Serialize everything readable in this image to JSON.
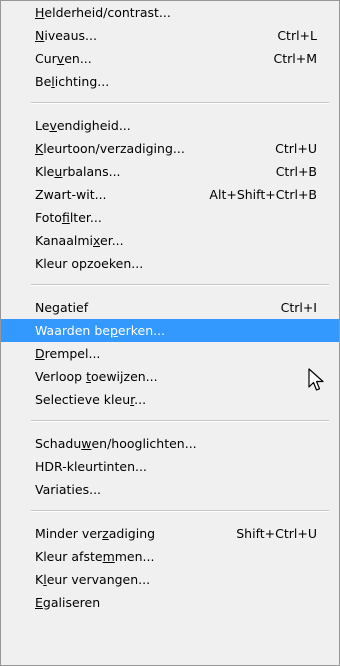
{
  "menu": {
    "groups": [
      {
        "items": [
          {
            "label": "Helderheid/contrast...",
            "shortcut": "",
            "accel": "H"
          },
          {
            "label": "Niveaus...",
            "shortcut": "Ctrl+L",
            "accel": "N"
          },
          {
            "label": "Curven...",
            "shortcut": "Ctrl+M",
            "accel": "v"
          },
          {
            "label": "Belichting...",
            "shortcut": "",
            "accel": "l"
          }
        ]
      },
      {
        "items": [
          {
            "label": "Levendigheid...",
            "shortcut": "",
            "accel": "v"
          },
          {
            "label": "Kleurtoon/verzadiging...",
            "shortcut": "Ctrl+U",
            "accel": "K"
          },
          {
            "label": "Kleurbalans...",
            "shortcut": "Ctrl+B",
            "accel": "u"
          },
          {
            "label": "Zwart-wit...",
            "shortcut": "Alt+Shift+Ctrl+B",
            "accel": ""
          },
          {
            "label": "Fotofilter...",
            "shortcut": "",
            "accel": "f"
          },
          {
            "label": "Kanaalmixer...",
            "shortcut": "",
            "accel": "x"
          },
          {
            "label": "Kleur opzoeken...",
            "shortcut": "",
            "accel": ""
          }
        ]
      },
      {
        "items": [
          {
            "label": "Negatief",
            "shortcut": "Ctrl+I",
            "accel": ""
          },
          {
            "label": "Waarden beperken...",
            "shortcut": "",
            "accel": "p",
            "highlighted": true
          },
          {
            "label": "Drempel...",
            "shortcut": "",
            "accel": "D"
          },
          {
            "label": "Verloop toewijzen...",
            "shortcut": "",
            "accel": "t"
          },
          {
            "label": "Selectieve kleur...",
            "shortcut": "",
            "accel": "r"
          }
        ]
      },
      {
        "items": [
          {
            "label": "Schaduwen/hooglichten...",
            "shortcut": "",
            "accel": "w"
          },
          {
            "label": "HDR-kleurtinten...",
            "shortcut": "",
            "accel": ""
          },
          {
            "label": "Variaties...",
            "shortcut": "",
            "accel": ""
          }
        ]
      },
      {
        "items": [
          {
            "label": "Minder verzadiging",
            "shortcut": "Shift+Ctrl+U",
            "accel": "z"
          },
          {
            "label": "Kleur afstemmen...",
            "shortcut": "",
            "accel": "m"
          },
          {
            "label": "Kleur vervangen...",
            "shortcut": "",
            "accel": "l"
          },
          {
            "label": "Egaliseren",
            "shortcut": "",
            "accel": "E"
          }
        ]
      }
    ],
    "colors": {
      "background": "#f0f0f0",
      "highlight": "#3399ff",
      "highlight_text": "#ffffff",
      "separator": "#c5c5c5",
      "border": "#979797"
    },
    "cursor_icon": "arrow-pointer-icon"
  }
}
